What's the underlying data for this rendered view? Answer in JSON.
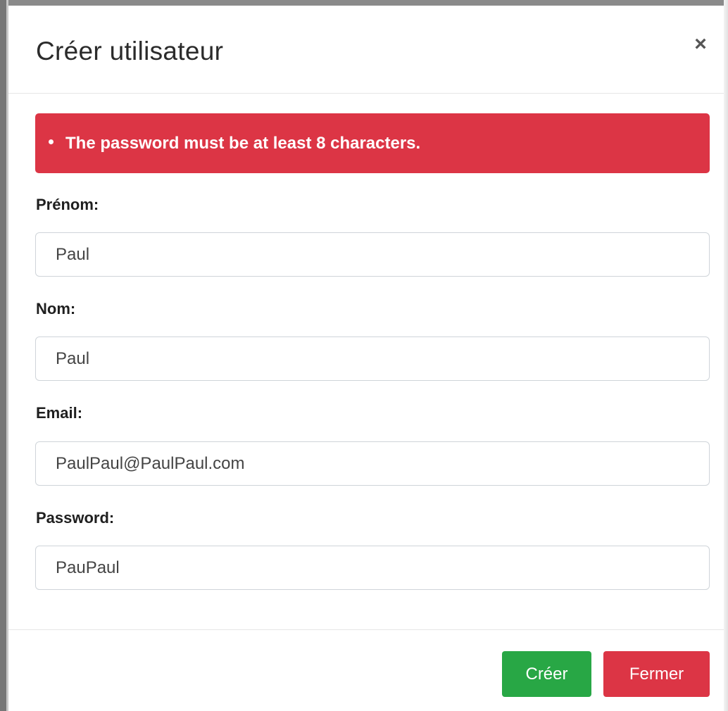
{
  "modal": {
    "title": "Créer utilisateur",
    "close_symbol": "×",
    "close_icon": "close-icon"
  },
  "alert": {
    "color": "#dc3545",
    "messages": [
      "The password must be at least 8 characters."
    ]
  },
  "form": {
    "fields": [
      {
        "label": "Prénom:",
        "value": "Paul"
      },
      {
        "label": "Nom:",
        "value": "Paul"
      },
      {
        "label": "Email:",
        "value": "PaulPaul@PaulPaul.com"
      },
      {
        "label": "Password:",
        "value": "PauPaul"
      }
    ]
  },
  "footer": {
    "create_label": "Créer",
    "create_color": "#28a745",
    "close_label": "Fermer",
    "close_color": "#dc3545"
  }
}
